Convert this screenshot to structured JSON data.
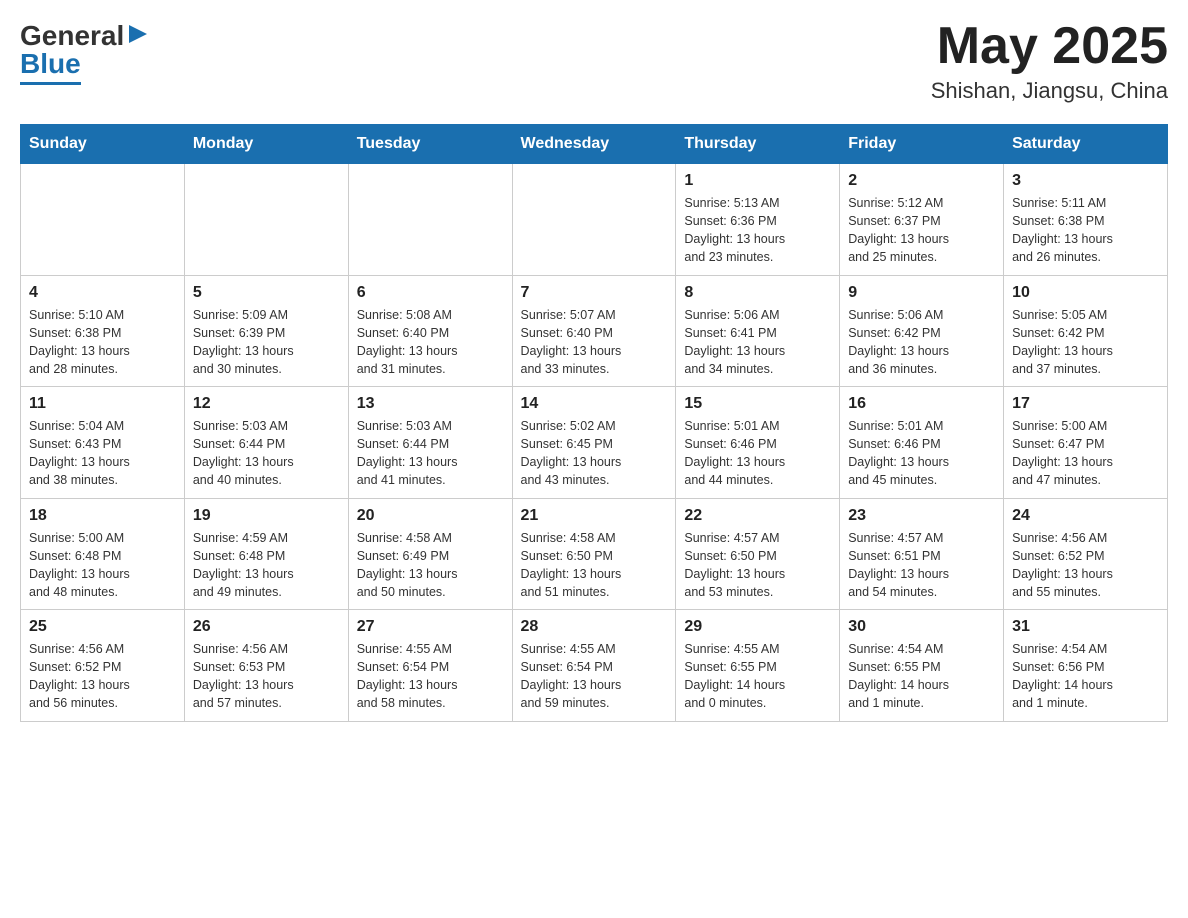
{
  "header": {
    "logo": {
      "general": "General",
      "blue": "Blue",
      "arrow_symbol": "▶"
    },
    "title": "May 2025",
    "location": "Shishan, Jiangsu, China"
  },
  "calendar": {
    "days_of_week": [
      "Sunday",
      "Monday",
      "Tuesday",
      "Wednesday",
      "Thursday",
      "Friday",
      "Saturday"
    ],
    "weeks": [
      [
        {
          "day": "",
          "info": ""
        },
        {
          "day": "",
          "info": ""
        },
        {
          "day": "",
          "info": ""
        },
        {
          "day": "",
          "info": ""
        },
        {
          "day": "1",
          "info": "Sunrise: 5:13 AM\nSunset: 6:36 PM\nDaylight: 13 hours\nand 23 minutes."
        },
        {
          "day": "2",
          "info": "Sunrise: 5:12 AM\nSunset: 6:37 PM\nDaylight: 13 hours\nand 25 minutes."
        },
        {
          "day": "3",
          "info": "Sunrise: 5:11 AM\nSunset: 6:38 PM\nDaylight: 13 hours\nand 26 minutes."
        }
      ],
      [
        {
          "day": "4",
          "info": "Sunrise: 5:10 AM\nSunset: 6:38 PM\nDaylight: 13 hours\nand 28 minutes."
        },
        {
          "day": "5",
          "info": "Sunrise: 5:09 AM\nSunset: 6:39 PM\nDaylight: 13 hours\nand 30 minutes."
        },
        {
          "day": "6",
          "info": "Sunrise: 5:08 AM\nSunset: 6:40 PM\nDaylight: 13 hours\nand 31 minutes."
        },
        {
          "day": "7",
          "info": "Sunrise: 5:07 AM\nSunset: 6:40 PM\nDaylight: 13 hours\nand 33 minutes."
        },
        {
          "day": "8",
          "info": "Sunrise: 5:06 AM\nSunset: 6:41 PM\nDaylight: 13 hours\nand 34 minutes."
        },
        {
          "day": "9",
          "info": "Sunrise: 5:06 AM\nSunset: 6:42 PM\nDaylight: 13 hours\nand 36 minutes."
        },
        {
          "day": "10",
          "info": "Sunrise: 5:05 AM\nSunset: 6:42 PM\nDaylight: 13 hours\nand 37 minutes."
        }
      ],
      [
        {
          "day": "11",
          "info": "Sunrise: 5:04 AM\nSunset: 6:43 PM\nDaylight: 13 hours\nand 38 minutes."
        },
        {
          "day": "12",
          "info": "Sunrise: 5:03 AM\nSunset: 6:44 PM\nDaylight: 13 hours\nand 40 minutes."
        },
        {
          "day": "13",
          "info": "Sunrise: 5:03 AM\nSunset: 6:44 PM\nDaylight: 13 hours\nand 41 minutes."
        },
        {
          "day": "14",
          "info": "Sunrise: 5:02 AM\nSunset: 6:45 PM\nDaylight: 13 hours\nand 43 minutes."
        },
        {
          "day": "15",
          "info": "Sunrise: 5:01 AM\nSunset: 6:46 PM\nDaylight: 13 hours\nand 44 minutes."
        },
        {
          "day": "16",
          "info": "Sunrise: 5:01 AM\nSunset: 6:46 PM\nDaylight: 13 hours\nand 45 minutes."
        },
        {
          "day": "17",
          "info": "Sunrise: 5:00 AM\nSunset: 6:47 PM\nDaylight: 13 hours\nand 47 minutes."
        }
      ],
      [
        {
          "day": "18",
          "info": "Sunrise: 5:00 AM\nSunset: 6:48 PM\nDaylight: 13 hours\nand 48 minutes."
        },
        {
          "day": "19",
          "info": "Sunrise: 4:59 AM\nSunset: 6:48 PM\nDaylight: 13 hours\nand 49 minutes."
        },
        {
          "day": "20",
          "info": "Sunrise: 4:58 AM\nSunset: 6:49 PM\nDaylight: 13 hours\nand 50 minutes."
        },
        {
          "day": "21",
          "info": "Sunrise: 4:58 AM\nSunset: 6:50 PM\nDaylight: 13 hours\nand 51 minutes."
        },
        {
          "day": "22",
          "info": "Sunrise: 4:57 AM\nSunset: 6:50 PM\nDaylight: 13 hours\nand 53 minutes."
        },
        {
          "day": "23",
          "info": "Sunrise: 4:57 AM\nSunset: 6:51 PM\nDaylight: 13 hours\nand 54 minutes."
        },
        {
          "day": "24",
          "info": "Sunrise: 4:56 AM\nSunset: 6:52 PM\nDaylight: 13 hours\nand 55 minutes."
        }
      ],
      [
        {
          "day": "25",
          "info": "Sunrise: 4:56 AM\nSunset: 6:52 PM\nDaylight: 13 hours\nand 56 minutes."
        },
        {
          "day": "26",
          "info": "Sunrise: 4:56 AM\nSunset: 6:53 PM\nDaylight: 13 hours\nand 57 minutes."
        },
        {
          "day": "27",
          "info": "Sunrise: 4:55 AM\nSunset: 6:54 PM\nDaylight: 13 hours\nand 58 minutes."
        },
        {
          "day": "28",
          "info": "Sunrise: 4:55 AM\nSunset: 6:54 PM\nDaylight: 13 hours\nand 59 minutes."
        },
        {
          "day": "29",
          "info": "Sunrise: 4:55 AM\nSunset: 6:55 PM\nDaylight: 14 hours\nand 0 minutes."
        },
        {
          "day": "30",
          "info": "Sunrise: 4:54 AM\nSunset: 6:55 PM\nDaylight: 14 hours\nand 1 minute."
        },
        {
          "day": "31",
          "info": "Sunrise: 4:54 AM\nSunset: 6:56 PM\nDaylight: 14 hours\nand 1 minute."
        }
      ]
    ]
  }
}
